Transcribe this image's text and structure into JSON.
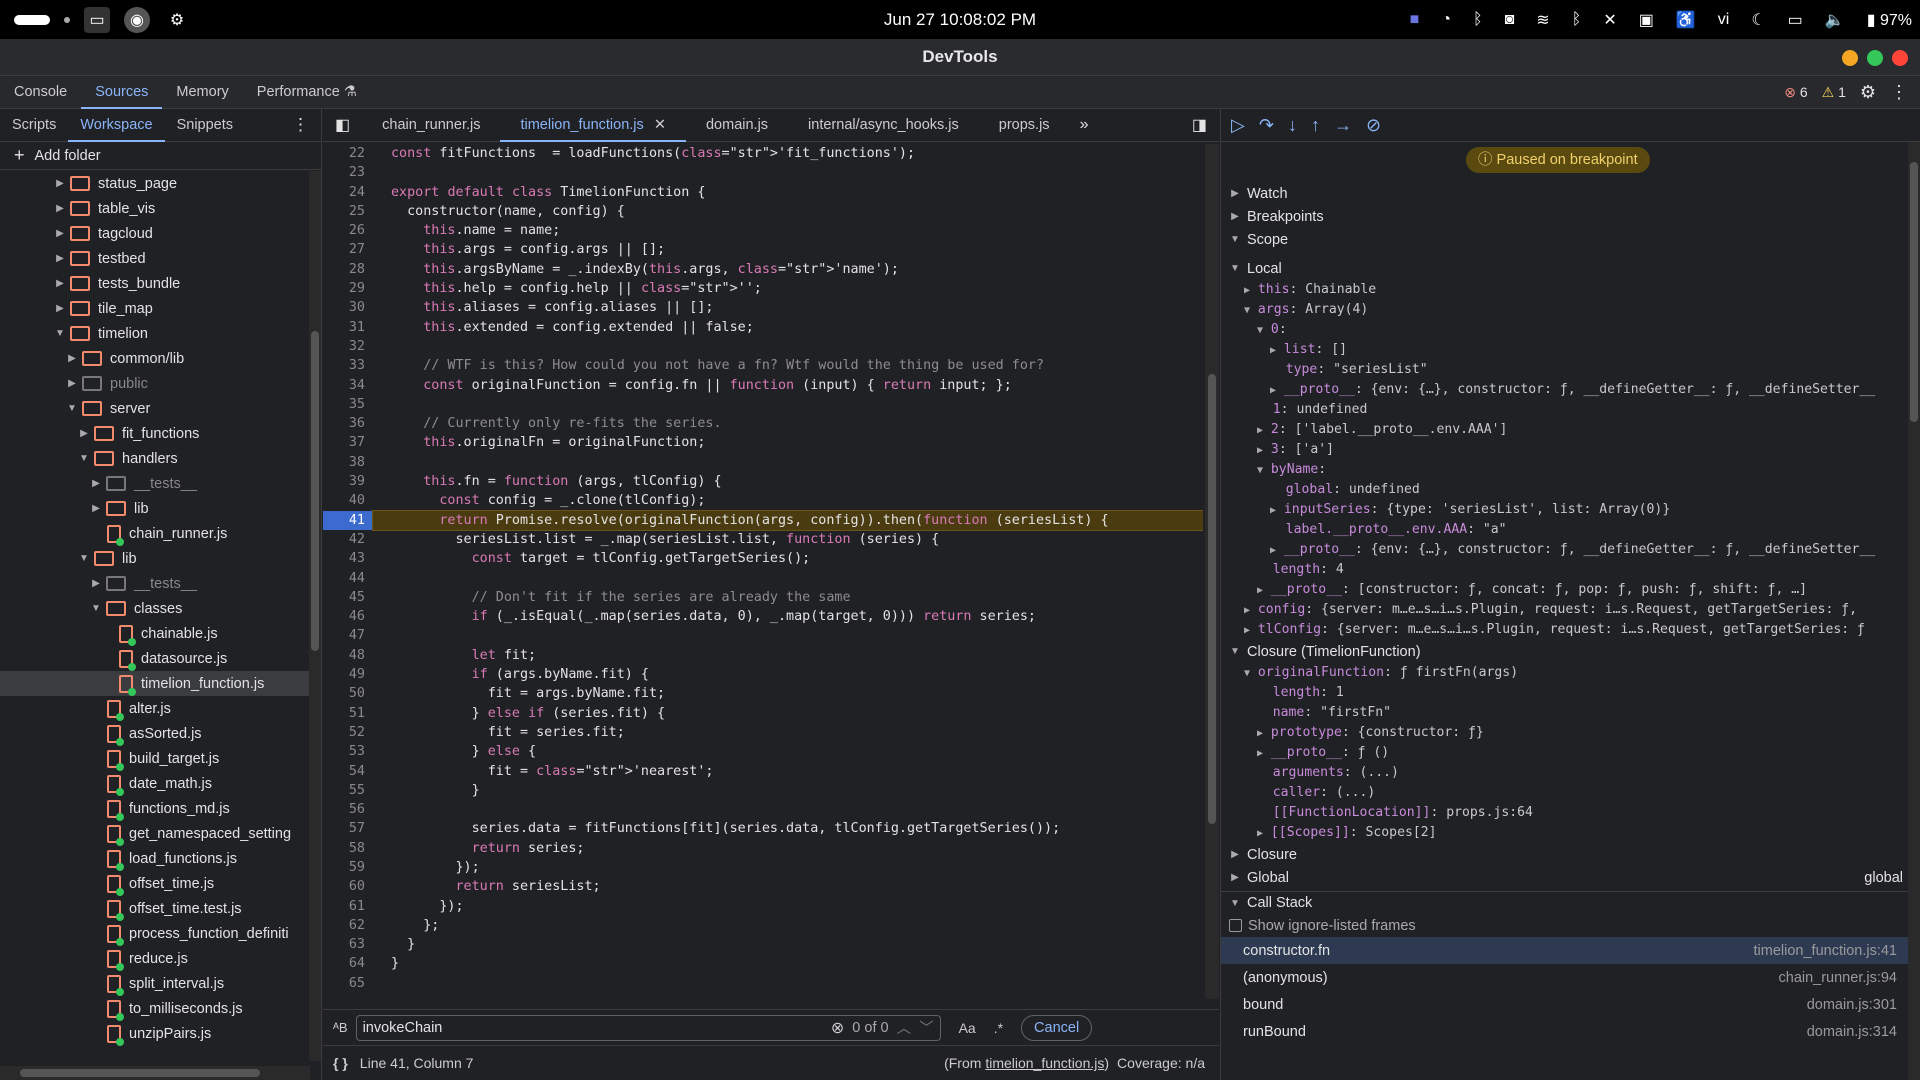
{
  "topbar": {
    "clock": "Jun 27  10:08:02 PM",
    "battery": "97%",
    "lang": "vi"
  },
  "window": {
    "title": "DevTools"
  },
  "main_tabs": [
    "Console",
    "Sources",
    "Memory",
    "Performance"
  ],
  "counts": {
    "errors": "6",
    "warnings": "1"
  },
  "nav": {
    "tabs": [
      "Scripts",
      "Workspace",
      "Snippets"
    ],
    "add_folder": "Add folder",
    "tree": [
      {
        "label": "status_page",
        "type": "folder",
        "depth": 0,
        "open": false
      },
      {
        "label": "table_vis",
        "type": "folder",
        "depth": 0,
        "open": false
      },
      {
        "label": "tagcloud",
        "type": "folder",
        "depth": 0,
        "open": false
      },
      {
        "label": "testbed",
        "type": "folder",
        "depth": 0,
        "open": false
      },
      {
        "label": "tests_bundle",
        "type": "folder",
        "depth": 0,
        "open": false
      },
      {
        "label": "tile_map",
        "type": "folder",
        "depth": 0,
        "open": false
      },
      {
        "label": "timelion",
        "type": "folder",
        "depth": 0,
        "open": true
      },
      {
        "label": "common/lib",
        "type": "folder",
        "depth": 1,
        "open": false
      },
      {
        "label": "public",
        "type": "folder",
        "depth": 1,
        "open": false,
        "dim": true
      },
      {
        "label": "server",
        "type": "folder",
        "depth": 1,
        "open": true
      },
      {
        "label": "fit_functions",
        "type": "folder",
        "depth": 2,
        "open": false
      },
      {
        "label": "handlers",
        "type": "folder",
        "depth": 2,
        "open": true
      },
      {
        "label": "__tests__",
        "type": "folder",
        "depth": 3,
        "open": false,
        "dim": true
      },
      {
        "label": "lib",
        "type": "folder",
        "depth": 3,
        "open": false
      },
      {
        "label": "chain_runner.js",
        "type": "file",
        "depth": 3
      },
      {
        "label": "lib",
        "type": "folder",
        "depth": 2,
        "open": true
      },
      {
        "label": "__tests__",
        "type": "folder",
        "depth": 3,
        "open": false,
        "dim": true
      },
      {
        "label": "classes",
        "type": "folder",
        "depth": 3,
        "open": true
      },
      {
        "label": "chainable.js",
        "type": "file",
        "depth": 4
      },
      {
        "label": "datasource.js",
        "type": "file",
        "depth": 4
      },
      {
        "label": "timelion_function.js",
        "type": "file",
        "depth": 4,
        "selected": true
      },
      {
        "label": "alter.js",
        "type": "file",
        "depth": 3
      },
      {
        "label": "asSorted.js",
        "type": "file",
        "depth": 3
      },
      {
        "label": "build_target.js",
        "type": "file",
        "depth": 3
      },
      {
        "label": "date_math.js",
        "type": "file",
        "depth": 3
      },
      {
        "label": "functions_md.js",
        "type": "file",
        "depth": 3
      },
      {
        "label": "get_namespaced_setting",
        "type": "file",
        "depth": 3
      },
      {
        "label": "load_functions.js",
        "type": "file",
        "depth": 3
      },
      {
        "label": "offset_time.js",
        "type": "file",
        "depth": 3
      },
      {
        "label": "offset_time.test.js",
        "type": "file",
        "depth": 3
      },
      {
        "label": "process_function_definiti",
        "type": "file",
        "depth": 3
      },
      {
        "label": "reduce.js",
        "type": "file",
        "depth": 3
      },
      {
        "label": "split_interval.js",
        "type": "file",
        "depth": 3
      },
      {
        "label": "to_milliseconds.js",
        "type": "file",
        "depth": 3
      },
      {
        "label": "unzipPairs.js",
        "type": "file",
        "depth": 3
      }
    ]
  },
  "editor": {
    "tabs": [
      "chain_runner.js",
      "timelion_function.js",
      "domain.js",
      "internal/async_hooks.js",
      "props.js"
    ],
    "active_tab": 1,
    "exec_line": 41,
    "lines": [
      {
        "n": "22",
        "t": "const fitFunctions  = loadFunctions('fit_functions');"
      },
      {
        "n": "23",
        "t": ""
      },
      {
        "n": "24",
        "t": "export default class TimelionFunction {"
      },
      {
        "n": "25",
        "t": "  constructor(name, config) {"
      },
      {
        "n": "26",
        "t": "    this.name = name;"
      },
      {
        "n": "27",
        "t": "    this.args = config.args || [];"
      },
      {
        "n": "28",
        "t": "    this.argsByName = _.indexBy(this.args, 'name');"
      },
      {
        "n": "29",
        "t": "    this.help = config.help || '';"
      },
      {
        "n": "30",
        "t": "    this.aliases = config.aliases || [];"
      },
      {
        "n": "31",
        "t": "    this.extended = config.extended || false;"
      },
      {
        "n": "32",
        "t": ""
      },
      {
        "n": "33",
        "t": "    // WTF is this? How could you not have a fn? Wtf would the thing be used for?"
      },
      {
        "n": "34",
        "t": "    const originalFunction = config.fn || function (input) { return input; };"
      },
      {
        "n": "35",
        "t": ""
      },
      {
        "n": "36",
        "t": "    // Currently only re-fits the series."
      },
      {
        "n": "37",
        "t": "    this.originalFn = originalFunction;"
      },
      {
        "n": "38",
        "t": ""
      },
      {
        "n": "39",
        "t": "    this.fn = function (args, tlConfig) {"
      },
      {
        "n": "40",
        "t": "      const config = _.clone(tlConfig);"
      },
      {
        "n": "41",
        "t": "      return Promise.resolve(originalFunction(args, config)).then(function (seriesList) {"
      },
      {
        "n": "42",
        "t": "        seriesList.list = _.map(seriesList.list, function (series) {"
      },
      {
        "n": "43",
        "t": "          const target = tlConfig.getTargetSeries();"
      },
      {
        "n": "44",
        "t": ""
      },
      {
        "n": "45",
        "t": "          // Don't fit if the series are already the same"
      },
      {
        "n": "46",
        "t": "          if (_.isEqual(_.map(series.data, 0), _.map(target, 0))) return series;"
      },
      {
        "n": "47",
        "t": ""
      },
      {
        "n": "48",
        "t": "          let fit;"
      },
      {
        "n": "49",
        "t": "          if (args.byName.fit) {"
      },
      {
        "n": "50",
        "t": "            fit = args.byName.fit;"
      },
      {
        "n": "51",
        "t": "          } else if (series.fit) {"
      },
      {
        "n": "52",
        "t": "            fit = series.fit;"
      },
      {
        "n": "53",
        "t": "          } else {"
      },
      {
        "n": "54",
        "t": "            fit = 'nearest';"
      },
      {
        "n": "55",
        "t": "          }"
      },
      {
        "n": "56",
        "t": ""
      },
      {
        "n": "57",
        "t": "          series.data = fitFunctions[fit](series.data, tlConfig.getTargetSeries());"
      },
      {
        "n": "58",
        "t": "          return series;"
      },
      {
        "n": "59",
        "t": "        });"
      },
      {
        "n": "60",
        "t": "        return seriesList;"
      },
      {
        "n": "61",
        "t": "      });"
      },
      {
        "n": "62",
        "t": "    };"
      },
      {
        "n": "63",
        "t": "  }"
      },
      {
        "n": "64",
        "t": "}"
      },
      {
        "n": "65",
        "t": ""
      }
    ],
    "search": {
      "value": "invokeChain",
      "count": "0 of 0",
      "match_case": "Aa",
      "regex": ".*",
      "cancel": "Cancel"
    },
    "status": {
      "position": "Line 41, Column 7",
      "from_prefix": "(From ",
      "from_file": "timelion_function.js",
      "from_suffix": ")",
      "coverage": "Coverage: n/a"
    }
  },
  "debugger": {
    "paused": "Paused on breakpoint",
    "sections": {
      "watch": "Watch",
      "breakpoints": "Breakpoints",
      "scope": "Scope",
      "local": "Local",
      "closure_fn": "Closure (TimelionFunction)",
      "closure": "Closure",
      "global": "Global",
      "global_right": "global",
      "call_stack": "Call Stack",
      "show_ignored": "Show ignore-listed frames"
    },
    "scope_lines": [
      "this: Chainable",
      "args: Array(4)",
      "0:",
      "list: []",
      "type: \"seriesList\"",
      "__proto__: {env: {…}, constructor: ƒ, __defineGetter__: ƒ, __defineSetter__",
      "1: undefined",
      "2: ['label.__proto__.env.AAA']",
      "3: ['a']",
      "byName:",
      "global: undefined",
      "inputSeries: {type: 'seriesList', list: Array(0)}",
      "label.__proto__.env.AAA: \"a\"",
      "__proto__: {env: {…}, constructor: ƒ, __defineGetter__: ƒ, __defineSetter__",
      "length: 4",
      "__proto__: [constructor: ƒ, concat: ƒ, pop: ƒ, push: ƒ, shift: ƒ, …]",
      "config: {server: m…e…s…i…s.Plugin, request: i…s.Request, getTargetSeries: ƒ,",
      "tlConfig: {server: m…e…s…i…s.Plugin, request: i…s.Request, getTargetSeries: ƒ"
    ],
    "closure_lines": [
      "originalFunction: ƒ firstFn(args)",
      "length: 1",
      "name: \"firstFn\"",
      "prototype: {constructor: ƒ}",
      "__proto__: ƒ ()",
      "arguments: (...)",
      "caller: (...)",
      "[[FunctionLocation]]: props.js:64",
      "[[Scopes]]: Scopes[2]"
    ],
    "call_stack": [
      {
        "name": "constructor.fn",
        "loc": "timelion_function.js:41"
      },
      {
        "name": "(anonymous)",
        "loc": "chain_runner.js:94"
      },
      {
        "name": "bound",
        "loc": "domain.js:301"
      },
      {
        "name": "runBound",
        "loc": "domain.js:314"
      }
    ]
  }
}
